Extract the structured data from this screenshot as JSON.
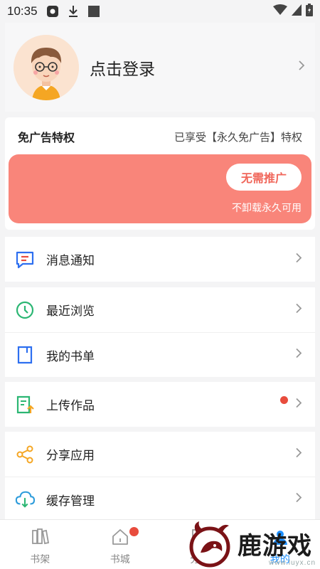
{
  "status_bar": {
    "time": "10:35"
  },
  "profile": {
    "login_label": "点击登录"
  },
  "adfree": {
    "title": "免广告特权",
    "status": "已享受【永久免广告】特权",
    "button_label": "无需推广",
    "note": "不卸载永久可用"
  },
  "groups": [
    {
      "items": [
        {
          "label": "消息通知",
          "icon": "message-icon"
        }
      ]
    },
    {
      "items": [
        {
          "label": "最近浏览",
          "icon": "clock-icon"
        },
        {
          "label": "我的书单",
          "icon": "booklist-icon"
        }
      ]
    },
    {
      "items": [
        {
          "label": "上传作品",
          "icon": "upload-icon",
          "badge": true
        }
      ]
    },
    {
      "items": [
        {
          "label": "分享应用",
          "icon": "share-icon"
        },
        {
          "label": "缓存管理",
          "icon": "cloud-download-icon"
        }
      ]
    }
  ],
  "bottom_nav": [
    {
      "label": "书架",
      "icon": "bookshelf-icon"
    },
    {
      "label": "书城",
      "icon": "home-icon",
      "badge": true
    },
    {
      "label": "分类",
      "icon": "category-icon"
    },
    {
      "label": "我的",
      "icon": "profile-icon",
      "active": true
    }
  ],
  "watermark": {
    "text": "鹿游戏",
    "url": "www.luyx.cn"
  },
  "colors": {
    "promo_bg": "#f9857a",
    "promo_button_text": "#f0665a",
    "badge_red": "#e84c3d",
    "active_blue": "#1e90ff"
  }
}
